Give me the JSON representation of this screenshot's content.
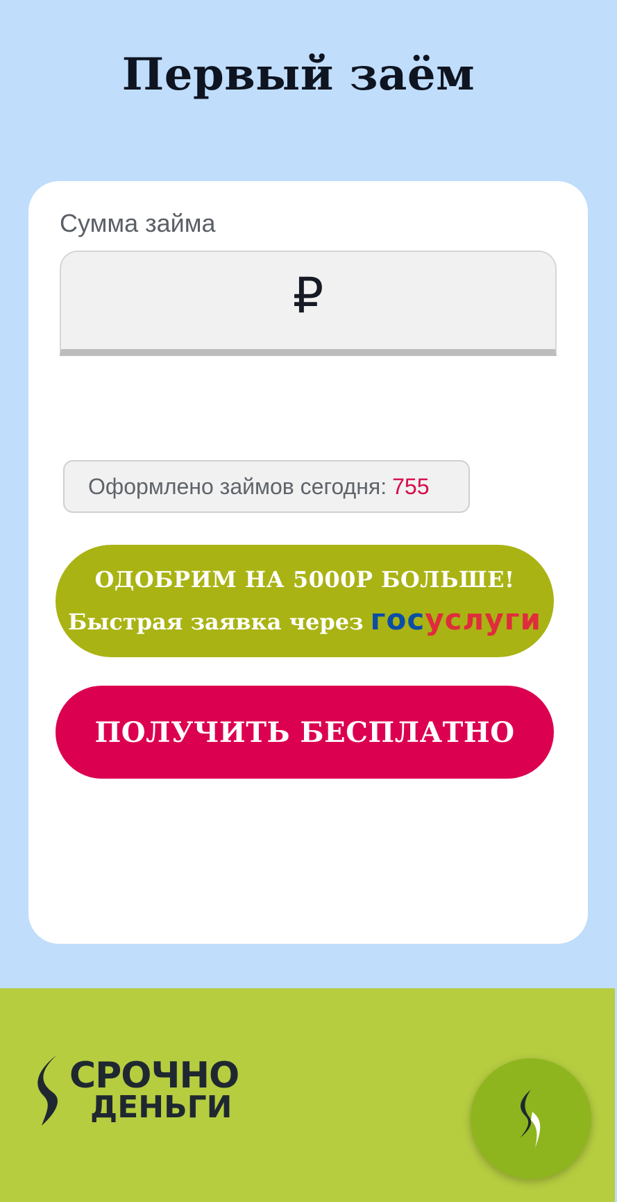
{
  "header": {
    "title": "Первый заём"
  },
  "form": {
    "amount_label": "Сумма займа",
    "currency_symbol": "₽",
    "counter_label": "Оформлено займов сегодня:",
    "counter_value": "755"
  },
  "gosuslugi_button": {
    "line1": "ОДОБРИМ НА 5000Р БОЛЬШЕ!",
    "line2": "Быстрая заявка через",
    "logo_part1": "гос",
    "logo_part2": "услуги"
  },
  "submit_button": {
    "label": "ПОЛУЧИТЬ БЕСПЛАТНО"
  },
  "footer": {
    "logo_line1": "СРОЧНО",
    "logo_line2": "ДЕНЬГИ"
  },
  "colors": {
    "background": "#c0ddfb",
    "accent_olive": "#a9b313",
    "accent_red": "#dc0050",
    "footer_green": "#b6cd40",
    "counter_value": "#d70c4a"
  },
  "icons": [
    "ruble-icon",
    "srochno-dengi-logo",
    "next-arrow-icon"
  ]
}
